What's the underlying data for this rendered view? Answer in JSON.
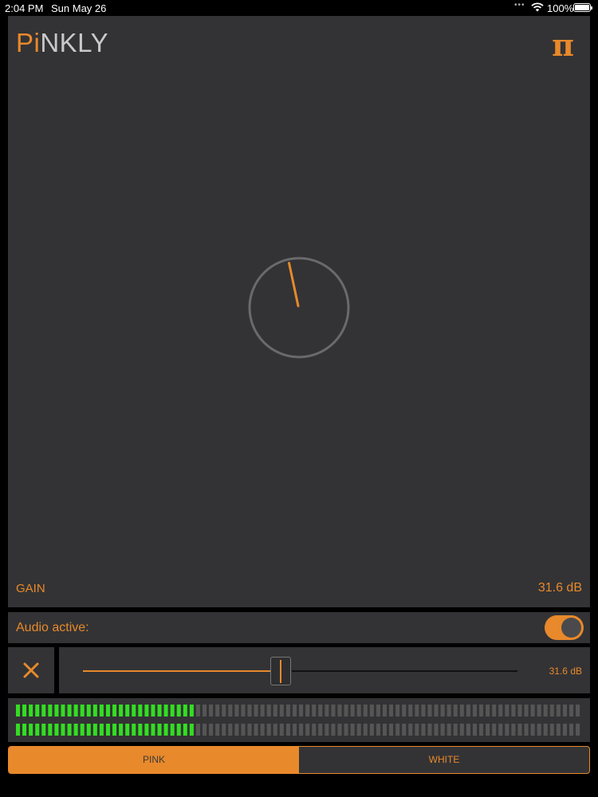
{
  "status_bar": {
    "time": "2:04 PM",
    "date": "Sun May 26",
    "dots": "•••",
    "battery_percent": "100%"
  },
  "app": {
    "logo_accent": "Pi",
    "logo_rest": "NKLY",
    "menu_icon": "pi-symbol-icon",
    "menu_glyph": "π"
  },
  "gain": {
    "label": "GAIN",
    "value": "31.6 dB"
  },
  "audio": {
    "label": "Audio active:",
    "enabled": true
  },
  "volume": {
    "close_glyph": "✕",
    "value_label": "31.6 dB",
    "position": 0.45
  },
  "meters": {
    "channels": [
      0.32,
      0.32
    ]
  },
  "noise_type": {
    "options": [
      "PINK",
      "WHITE"
    ],
    "selected": "PINK"
  },
  "colors": {
    "accent": "#e8892b",
    "panel": "#333335",
    "meter_on": "#33dd22",
    "meter_off": "#555555"
  }
}
